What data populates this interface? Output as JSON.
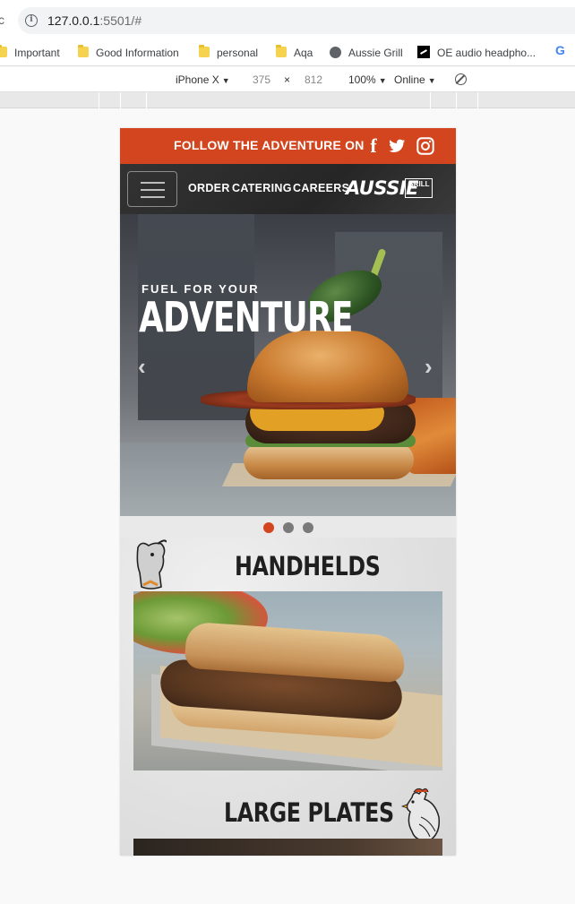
{
  "browser": {
    "url_host": "127.0.0.1",
    "url_rest": ":5501/#",
    "bookmarks": [
      {
        "label": "Important",
        "icon": "folder-icon"
      },
      {
        "label": "Good Information",
        "icon": "folder-icon"
      },
      {
        "label": "personal",
        "icon": "folder-icon"
      },
      {
        "label": "Aqa",
        "icon": "folder-icon"
      },
      {
        "label": "Aussie Grill",
        "icon": "globe-icon"
      },
      {
        "label": "OE audio headpho...",
        "icon": "oe-icon"
      }
    ],
    "google_icon": "G"
  },
  "devtools": {
    "device": "iPhone X",
    "width": "375",
    "times": "×",
    "height": "812",
    "zoom": "100%",
    "network": "Online"
  },
  "site": {
    "follow_text": "FOLLOW THE ADVENTURE ON",
    "social": [
      {
        "name": "facebook",
        "glyph": "f"
      },
      {
        "name": "twitter",
        "glyph": "t"
      },
      {
        "name": "instagram",
        "glyph": "◎"
      }
    ],
    "nav": {
      "order": "ORDER",
      "catering": "CATERING",
      "careers": "CAREERS",
      "brand": "AUSSIE",
      "brand_box": "GRILL"
    },
    "hero": {
      "kicker": "FUEL FOR YOUR",
      "title": "ADVENTURE",
      "prev": "‹",
      "next": "›",
      "slide_count": 3,
      "active_slide": 1
    },
    "sections": [
      {
        "title": "HANDHELDS"
      },
      {
        "title": "LARGE PLATES"
      }
    ]
  },
  "colors": {
    "accent": "#d2451e",
    "nav_bg": "#2e2e2e"
  }
}
